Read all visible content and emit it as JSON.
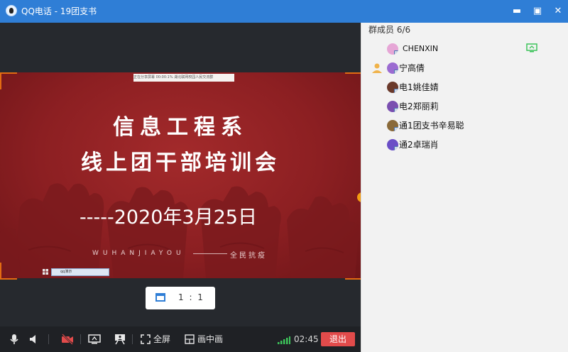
{
  "window": {
    "title": "QQ电话 - 19团支书",
    "minimize_symbol": "▬",
    "maximize_symbol": "▣",
    "close_symbol": "✕"
  },
  "slide": {
    "top_bar_text": "正在分享屏幕  00:00:1%  湖北联网校园人民交流群",
    "title_line1": "信息工程系",
    "title_line2": "线上团干部培训会",
    "date": "-----2020年3月25日",
    "subtitle_en": "WUHANJIAYOU",
    "subtitle_cn": "全民抗疫",
    "taskbar_text": "qq演示"
  },
  "view_ratio": {
    "label": "1 : 1"
  },
  "members": {
    "header": "群成员 6/6",
    "items": [
      {
        "name": "CHENXIN",
        "host": false,
        "sharing_screen": true,
        "avatar_color": "#e6a6d6"
      },
      {
        "name": "宁高倩",
        "host": true,
        "sharing_screen": false,
        "avatar_color": "#9b6bd1"
      },
      {
        "name": "电1姚佳婧",
        "host": false,
        "sharing_screen": false,
        "avatar_color": "#6b3a2b"
      },
      {
        "name": "电2郑丽莉",
        "host": false,
        "sharing_screen": false,
        "avatar_color": "#7a4fb0"
      },
      {
        "name": "通1团支书辛易聪",
        "host": false,
        "sharing_screen": false,
        "avatar_color": "#8a6a3a"
      },
      {
        "name": "通2卓瑞肖",
        "host": false,
        "sharing_screen": false,
        "avatar_color": "#6a4ec6"
      }
    ]
  },
  "toolbar": {
    "fullscreen_label": "全屏",
    "pip_label": "画中画",
    "timer": "02:45",
    "exit_label": "退出"
  },
  "colors": {
    "title_bar": "#2f7ed6",
    "slide_red": "#8c1f22",
    "exit_button": "#e24b4b",
    "signal_green": "#3cc35a",
    "accent_orange": "#e36b12"
  }
}
